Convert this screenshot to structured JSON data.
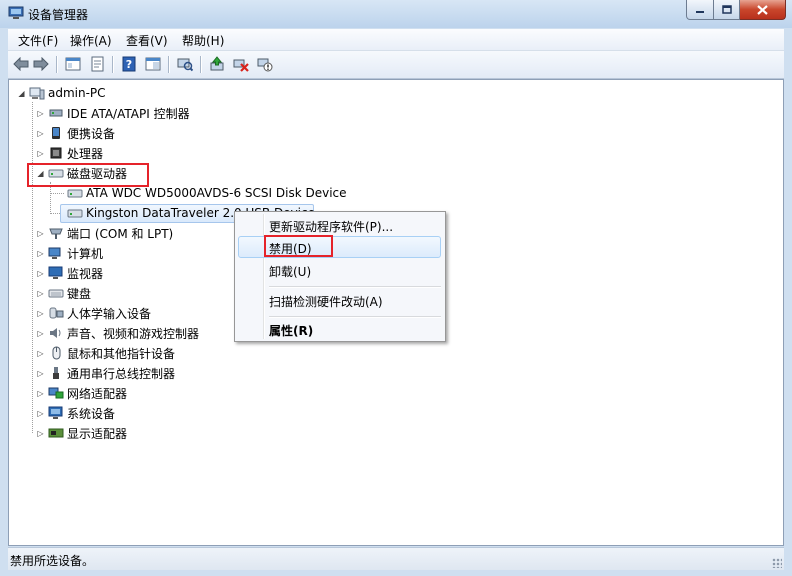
{
  "window": {
    "title": "设备管理器",
    "min_icon": "minimize-icon",
    "max_icon": "maximize-icon",
    "close_icon": "close-icon"
  },
  "menubar": {
    "items": [
      "文件(F)",
      "操作(A)",
      "查看(V)",
      "帮助(H)"
    ]
  },
  "toolbar": {
    "icons": [
      "back-arrow-icon",
      "forward-arrow-icon",
      "tree-view-icon",
      "properties-sheet-icon",
      "help-icon",
      "view-pane-icon",
      "scan-hardware-icon",
      "update-driver-icon",
      "uninstall-icon",
      "disable-device-icon"
    ]
  },
  "tree": {
    "root": "admin-PC",
    "categories": [
      "IDE ATA/ATAPI 控制器",
      "便携设备",
      "处理器",
      "磁盘驱动器",
      "端口 (COM 和 LPT)",
      "计算机",
      "监视器",
      "键盘",
      "人体学输入设备",
      "声音、视频和游戏控制器",
      "鼠标和其他指针设备",
      "通用串行总线控制器",
      "网络适配器",
      "系统设备",
      "显示适配器"
    ],
    "disk_children": [
      "ATA WDC WD5000AVDS-6 SCSI Disk Device",
      "Kingston DataTraveler 2.0 USB Device"
    ]
  },
  "context_menu": {
    "update_driver": "更新驱动程序软件(P)...",
    "disable": "禁用(D)",
    "uninstall": "卸载(U)",
    "scan": "扫描检测硬件改动(A)",
    "properties": "属性(R)"
  },
  "statusbar": {
    "text": "禁用所选设备。"
  },
  "colors": {
    "highlight_red": "#e5232a",
    "selection": "#d9e9fb"
  }
}
